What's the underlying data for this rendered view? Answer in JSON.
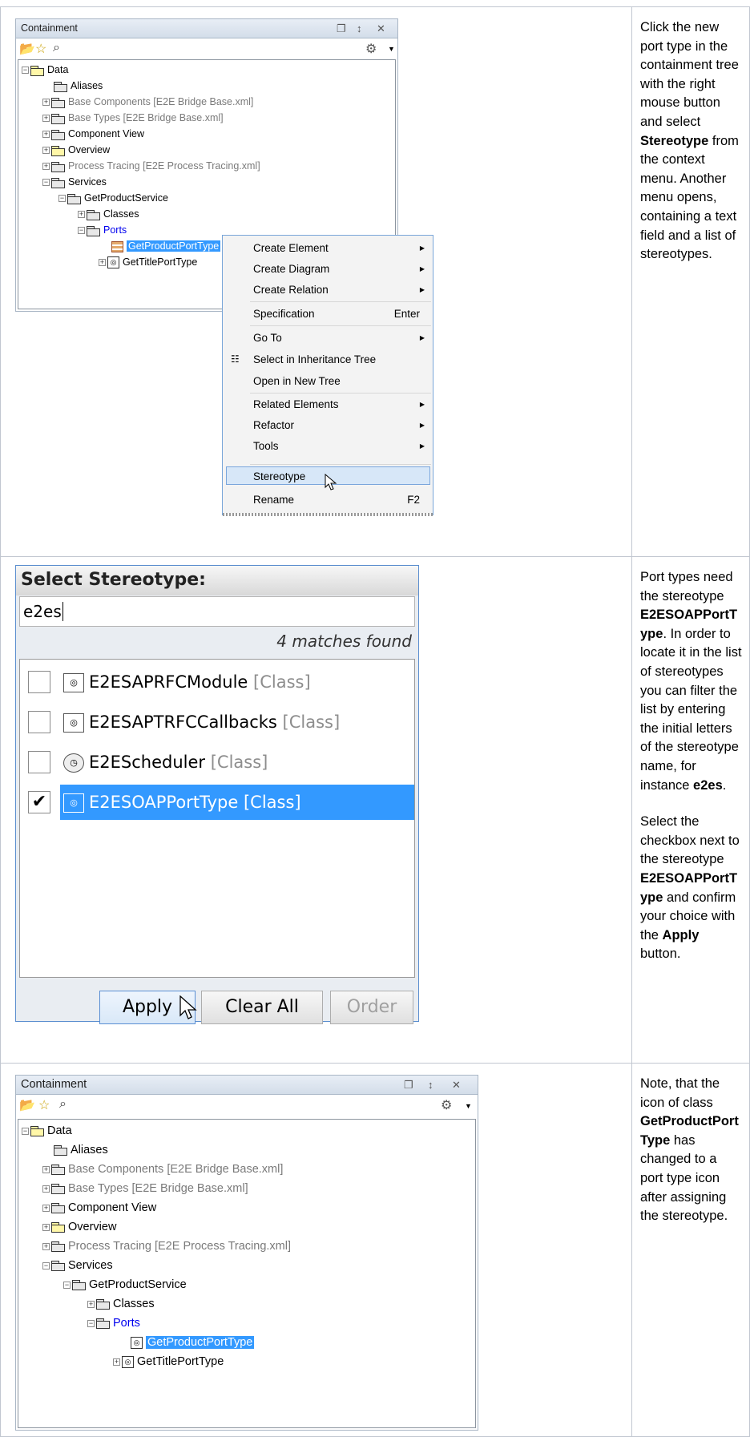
{
  "row1": {
    "panel": {
      "title": "Containment",
      "tree": {
        "data": "Data",
        "aliases": "Aliases",
        "base_components": "Base Components [E2E Bridge Base.xml]",
        "base_types": "Base Types [E2E Bridge Base.xml]",
        "component_view": "Component View",
        "overview": "Overview",
        "process_tracing": "Process Tracing [E2E Process Tracing.xml]",
        "services": "Services",
        "get_product_service": "GetProductService",
        "classes": "Classes",
        "ports": "Ports",
        "get_product_port_type": "GetProductPortType",
        "get_title_port_type": "GetTitlePortType"
      }
    },
    "menu": {
      "create_element": "Create Element",
      "create_diagram": "Create Diagram",
      "create_relation": "Create Relation",
      "specification": "Specification",
      "specification_shortcut": "Enter",
      "go_to": "Go To",
      "select_inheritance": "Select in Inheritance Tree",
      "open_new_tree": "Open in New Tree",
      "related_elements": "Related Elements",
      "refactor": "Refactor",
      "tools": "Tools",
      "stereotype": "Stereotype",
      "rename": "Rename",
      "rename_shortcut": "F2"
    },
    "text": {
      "t1": "Click the new port type in the containment tree with the right mouse button and select ",
      "t2": "Stereotype",
      "t3": " from the context menu. Another menu opens, containing a text field and a list of stereotypes."
    }
  },
  "row2": {
    "dialog": {
      "title": "Select Stereotype:",
      "search_value": "e2es",
      "matches": "4 matches found",
      "items": [
        {
          "name": "E2ESAPRFCModule",
          "meta": "[Class]",
          "checked": false
        },
        {
          "name": "E2ESAPTRFCCallbacks",
          "meta": "[Class]",
          "checked": false
        },
        {
          "name": "E2EScheduler",
          "meta": "[Class]",
          "checked": false
        },
        {
          "name": "E2ESOAPPortType",
          "meta": "[Class]",
          "checked": true
        }
      ],
      "apply": "Apply",
      "clear_all": "Clear All",
      "order": "Order"
    },
    "text": {
      "p1a": "Port types need the stereotype ",
      "p1b": "E2ESOAPPortType",
      "p1c": ". In order to locate it in the list of stereotypes you can filter the list by entering the initial letters of the stereotype name, for instance ",
      "p1d": "e2es",
      "p1e": ".",
      "p2a": "Select the checkbox next to the stereotype ",
      "p2b": "E2ESOAPPortType",
      "p2c": " and confirm your choice with the ",
      "p2d": "Apply",
      "p2e": " button."
    }
  },
  "row3": {
    "text": {
      "t1": "Note, that the icon of class ",
      "t2": "GetProductPortType",
      "t3": " has changed to a port type icon after assigning the stereotype."
    }
  },
  "colors": {
    "selection": "#3399ff",
    "link_blue": "#0000ee",
    "grid_border": "#c1c7d0"
  }
}
